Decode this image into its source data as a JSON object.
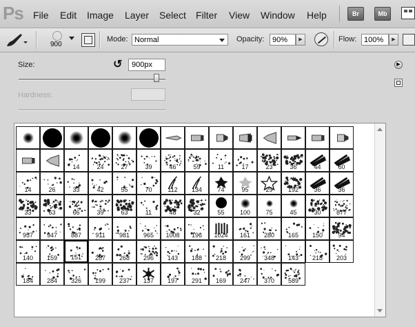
{
  "app": {
    "logo": "Ps"
  },
  "menu": [
    "File",
    "Edit",
    "Image",
    "Layer",
    "Select",
    "Filter",
    "View",
    "Window",
    "Help"
  ],
  "app_buttons": [
    "Br",
    "Mb"
  ],
  "options_bar": {
    "brush_size": "900",
    "mode_label": "Mode:",
    "mode_value": "Normal",
    "opacity_label": "Opacity:",
    "opacity_value": "90%",
    "flow_label": "Flow:",
    "flow_value": "100%"
  },
  "brush_panel": {
    "size_label": "Size:",
    "size_value": "900px",
    "size_fraction": 0.94,
    "hardness_label": "Hardness:"
  },
  "brush_grid": {
    "rows": [
      [
        {
          "type": "soft",
          "d": 16,
          "n": ""
        },
        {
          "type": "round",
          "d": 28,
          "n": ""
        },
        {
          "type": "soft",
          "d": 20,
          "n": ""
        },
        {
          "type": "round",
          "d": 28,
          "n": ""
        },
        {
          "type": "soft",
          "d": 20,
          "n": ""
        },
        {
          "type": "round",
          "d": 28,
          "n": ""
        },
        {
          "type": "tip",
          "kind": "pencil",
          "n": ""
        },
        {
          "type": "tip",
          "kind": "chisel",
          "n": ""
        },
        {
          "type": "tip",
          "kind": "flat",
          "n": ""
        },
        {
          "type": "tip",
          "kind": "angle",
          "n": ""
        },
        {
          "type": "tip",
          "kind": "fan",
          "n": ""
        },
        {
          "type": "tip",
          "kind": "point",
          "n": ""
        },
        {
          "type": "tip",
          "kind": "chisel",
          "n": ""
        },
        {
          "type": "tip",
          "kind": "flat",
          "n": ""
        }
      ],
      [
        {
          "type": "tip",
          "kind": "chisel",
          "n": ""
        },
        {
          "type": "tip",
          "kind": "fan",
          "n": ""
        },
        {
          "type": "dots",
          "n": "14"
        },
        {
          "type": "splat",
          "n": "24"
        },
        {
          "type": "splat",
          "n": "27"
        },
        {
          "type": "dots",
          "n": "39"
        },
        {
          "type": "splat",
          "n": "46"
        },
        {
          "type": "splat",
          "n": "59"
        },
        {
          "type": "dots",
          "n": "11"
        },
        {
          "type": "dots",
          "n": "17"
        },
        {
          "type": "dark",
          "n": "23"
        },
        {
          "type": "dark",
          "n": "36"
        },
        {
          "type": "stroke",
          "n": "44"
        },
        {
          "type": "stroke",
          "n": "60"
        }
      ],
      [
        {
          "type": "dots",
          "n": "14"
        },
        {
          "type": "dots",
          "n": "26"
        },
        {
          "type": "dots",
          "n": "33"
        },
        {
          "type": "dots",
          "n": "42"
        },
        {
          "type": "dots",
          "n": "55"
        },
        {
          "type": "dots",
          "n": "70"
        },
        {
          "type": "grass",
          "n": "112"
        },
        {
          "type": "grass",
          "n": "134"
        },
        {
          "type": "leaf",
          "n": "74"
        },
        {
          "type": "leaf",
          "n": "95"
        },
        {
          "type": "star",
          "n": "29"
        },
        {
          "type": "dark",
          "n": "192"
        },
        {
          "type": "stroke",
          "n": "36"
        },
        {
          "type": "stroke",
          "n": "36"
        }
      ],
      [
        {
          "type": "dark",
          "n": "33"
        },
        {
          "type": "dark",
          "n": "63"
        },
        {
          "type": "splat",
          "n": "66"
        },
        {
          "type": "splat",
          "n": "39"
        },
        {
          "type": "dark",
          "n": "63"
        },
        {
          "type": "dots",
          "n": "11"
        },
        {
          "type": "dark",
          "n": "48"
        },
        {
          "type": "dark",
          "n": "32"
        },
        {
          "type": "blob",
          "d": 16,
          "n": "55"
        },
        {
          "type": "soft",
          "d": 14,
          "n": "100"
        },
        {
          "type": "soft",
          "d": 10,
          "n": "75"
        },
        {
          "type": "soft",
          "d": 12,
          "n": "45"
        },
        {
          "type": "dark",
          "n": "30"
        },
        {
          "type": "splat",
          "n": "877"
        }
      ],
      [
        {
          "type": "dots",
          "n": "957"
        },
        {
          "type": "dots",
          "n": "947"
        },
        {
          "type": "dots",
          "n": "887"
        },
        {
          "type": "dots",
          "n": "911"
        },
        {
          "type": "dots",
          "n": "981"
        },
        {
          "type": "dots",
          "n": "965"
        },
        {
          "type": "dots",
          "n": "1008"
        },
        {
          "type": "dots",
          "n": "196"
        },
        {
          "type": "bristle",
          "n": "1024"
        },
        {
          "type": "dots",
          "n": "161"
        },
        {
          "type": "dots",
          "n": "280"
        },
        {
          "type": "dots",
          "n": "165"
        },
        {
          "type": "dots",
          "n": "150"
        },
        {
          "type": "dark",
          "n": "94"
        }
      ],
      [
        {
          "type": "dots",
          "n": "140"
        },
        {
          "type": "dots",
          "n": "159"
        },
        {
          "type": "dots",
          "n": "151",
          "selected": true
        },
        {
          "type": "dots",
          "n": "287"
        },
        {
          "type": "dots",
          "n": "268"
        },
        {
          "type": "splat",
          "n": "296"
        },
        {
          "type": "dots",
          "n": "143"
        },
        {
          "type": "dots",
          "n": "188"
        },
        {
          "type": "dots",
          "n": "218"
        },
        {
          "type": "dots",
          "n": "299"
        },
        {
          "type": "dots",
          "n": "348"
        },
        {
          "type": "dots",
          "n": "143"
        },
        {
          "type": "dots",
          "n": "218"
        },
        {
          "type": "dots",
          "n": "203"
        }
      ],
      [
        {
          "type": "dots",
          "n": "184"
        },
        {
          "type": "dots",
          "n": "284"
        },
        {
          "type": "dots",
          "n": "326"
        },
        {
          "type": "dots",
          "n": "199"
        },
        {
          "type": "dots",
          "n": "237"
        },
        {
          "type": "flake",
          "n": "137"
        },
        {
          "type": "dots",
          "n": "197"
        },
        {
          "type": "dots",
          "n": "291"
        },
        {
          "type": "dots",
          "n": "169"
        },
        {
          "type": "dots",
          "n": "247"
        },
        {
          "type": "dots",
          "n": "370"
        },
        {
          "type": "splat",
          "n": "589"
        }
      ]
    ]
  }
}
